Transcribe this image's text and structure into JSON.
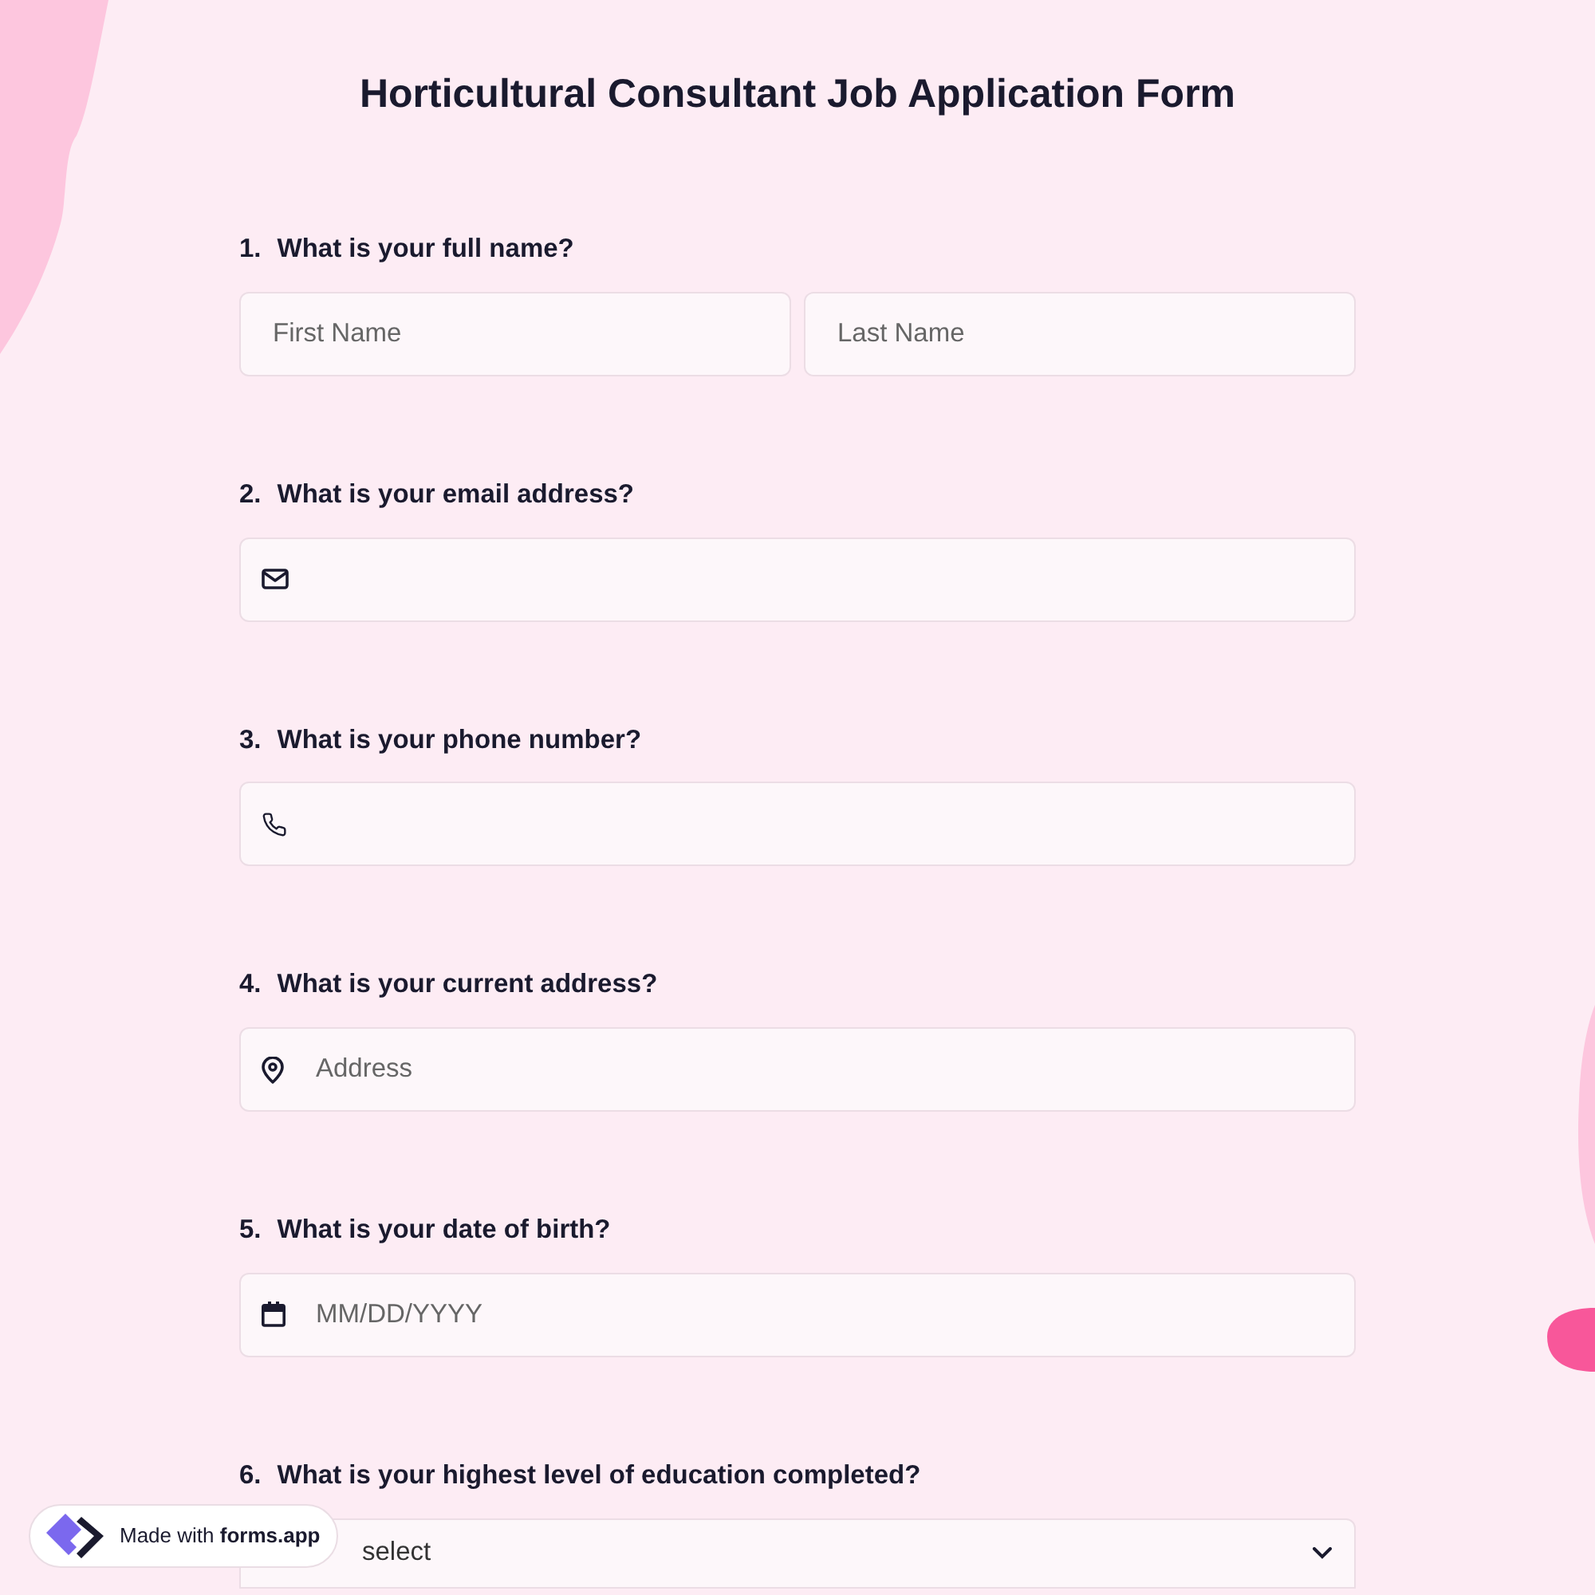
{
  "title": "Horticultural Consultant Job Application Form",
  "questions": [
    {
      "number": "1.",
      "label": "What is your full name?",
      "kind": "name",
      "fields": [
        {
          "placeholder": "First Name"
        },
        {
          "placeholder": "Last Name"
        }
      ]
    },
    {
      "number": "2.",
      "label": "What is your email address?",
      "kind": "email"
    },
    {
      "number": "3.",
      "label": "What is your phone number?",
      "kind": "phone"
    },
    {
      "number": "4.",
      "label": "What is your current address?",
      "kind": "address",
      "fields": [
        {
          "placeholder": "Address"
        }
      ]
    },
    {
      "number": "5.",
      "label": "What is your date of birth?",
      "kind": "date",
      "fields": [
        {
          "placeholder": "MM/DD/YYYY"
        }
      ]
    },
    {
      "number": "6.",
      "label": "What is your highest level of education completed?",
      "kind": "select",
      "fields": [
        {
          "placeholder": "select"
        }
      ]
    }
  ],
  "badge": {
    "prefix": "Made with",
    "brand": "forms.app"
  }
}
